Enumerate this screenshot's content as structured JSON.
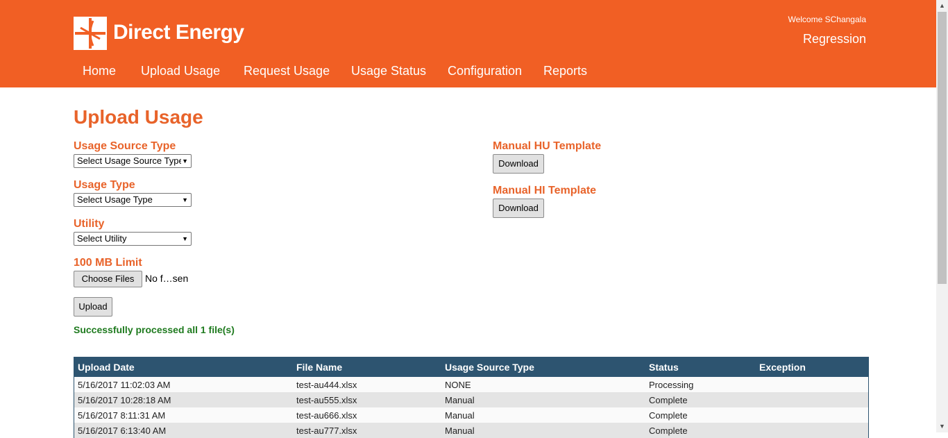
{
  "header": {
    "brand": "Direct Energy",
    "welcome": "Welcome SChangala",
    "environment": "Regression",
    "brand_color": "#f15f24"
  },
  "nav": [
    {
      "label": "Home"
    },
    {
      "label": "Upload Usage"
    },
    {
      "label": "Request Usage"
    },
    {
      "label": "Usage Status"
    },
    {
      "label": "Configuration"
    },
    {
      "label": "Reports"
    }
  ],
  "page": {
    "title": "Upload Usage",
    "usage_source_type": {
      "label": "Usage Source Type",
      "selected": "Select Usage Source Type"
    },
    "usage_type": {
      "label": "Usage Type",
      "selected": "Select Usage Type"
    },
    "utility": {
      "label": "Utility",
      "selected": "Select Utility"
    },
    "file_limit": {
      "label": "100 MB Limit",
      "button": "Choose Files",
      "status": "No f…sen"
    },
    "upload_button": "Upload",
    "success_message": "Successfully processed all 1 file(s)",
    "manual_hu": {
      "label": "Manual HU Template",
      "button": "Download"
    },
    "manual_hi": {
      "label": "Manual HI Template",
      "button": "Download"
    }
  },
  "table": {
    "columns": [
      "Upload Date",
      "File Name",
      "Usage Source Type",
      "Status",
      "Exception"
    ],
    "rows": [
      {
        "date": "5/16/2017 11:02:03 AM",
        "file": "test-au444.xlsx",
        "source": "NONE",
        "status": "Processing",
        "exception": ""
      },
      {
        "date": "5/16/2017 10:28:18 AM",
        "file": "test-au555.xlsx",
        "source": "Manual",
        "status": "Complete",
        "exception": ""
      },
      {
        "date": "5/16/2017 8:11:31 AM",
        "file": "test-au666.xlsx",
        "source": "Manual",
        "status": "Complete",
        "exception": ""
      },
      {
        "date": "5/16/2017 6:13:40 AM",
        "file": "test-au777.xlsx",
        "source": "Manual",
        "status": "Complete",
        "exception": ""
      }
    ],
    "header_color": "#2d5470"
  }
}
